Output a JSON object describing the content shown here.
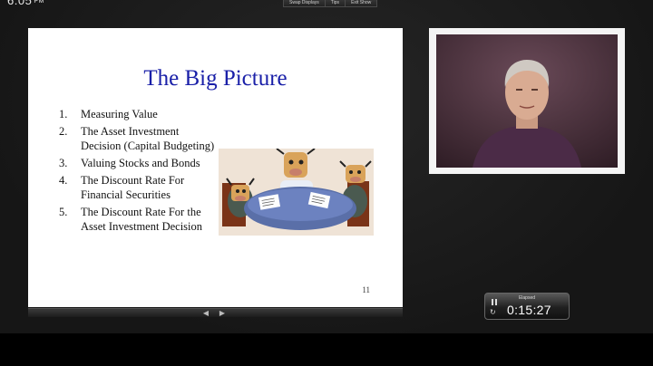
{
  "presenter": {
    "clock": "6:05",
    "clock_ampm": "PM",
    "toolbar": [
      "Swap Displays",
      "Tips",
      "Exit Show"
    ]
  },
  "slide": {
    "title": "The Big Picture",
    "items": [
      {
        "num": "1.",
        "text": "Measuring Value"
      },
      {
        "num": "2.",
        "text": "The Asset Investment Decision (Capital Budgeting)"
      },
      {
        "num": "3.",
        "text": "Valuing Stocks and Bonds"
      },
      {
        "num": "4.",
        "text": "The Discount Rate For Financial Securities"
      },
      {
        "num": "5.",
        "text": "The Discount Rate For the Asset Investment Decision"
      }
    ],
    "page_number": "11"
  },
  "navigation": {
    "prev_icon": "arrow-left-icon",
    "next_icon": "arrow-right-icon",
    "prev_glyph": "◀",
    "next_glyph": "▶"
  },
  "timer": {
    "label": "Elapsed",
    "value": "0:15:27",
    "pause_icon": "pause-icon",
    "reset_icon": "reset-icon",
    "reset_glyph": "↻"
  },
  "colors": {
    "title": "#1a20a8",
    "background": "#1e1e1e"
  }
}
